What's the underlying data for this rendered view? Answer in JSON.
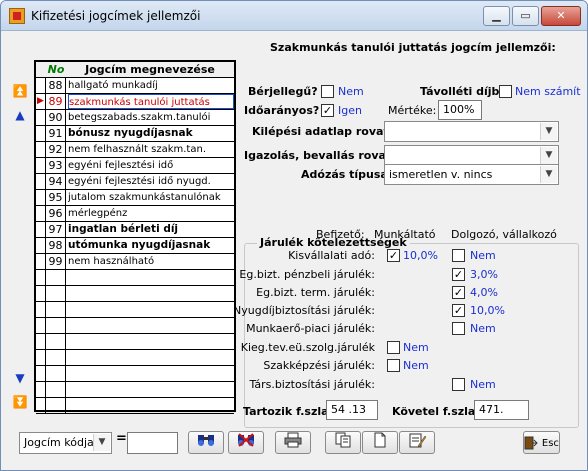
{
  "window": {
    "title": "Kifizetési jogcímek jellemzői",
    "minimize_glyph": "▁",
    "maximize_glyph": "▭",
    "close_glyph": "✕"
  },
  "nav": {
    "first_glyph": "⏫",
    "prev_glyph": "▲",
    "next_glyph": "▼",
    "last_glyph": "⏬"
  },
  "grid": {
    "col_no": "No",
    "col_name": "Jogcím megnevezése",
    "rows": [
      {
        "no": "88",
        "name": "hallgató munkadíj",
        "bold": false,
        "selected": false
      },
      {
        "no": "89",
        "name": "szakmunkás tanulói juttatás",
        "bold": false,
        "selected": true,
        "marker": "▶"
      },
      {
        "no": "90",
        "name": "betegszabads.szakm.tanulói",
        "bold": false,
        "selected": false
      },
      {
        "no": "91",
        "name": "bónusz nyugdíjasnak",
        "bold": true,
        "selected": false
      },
      {
        "no": "92",
        "name": "nem felhasznált szakm.tan.",
        "bold": false,
        "selected": false
      },
      {
        "no": "93",
        "name": "egyéni fejlesztési idő",
        "bold": false,
        "selected": false
      },
      {
        "no": "94",
        "name": "egyéni fejlesztési idő nyugd.",
        "bold": false,
        "selected": false
      },
      {
        "no": "95",
        "name": "jutalom szakmunkástanulónak",
        "bold": false,
        "selected": false
      },
      {
        "no": "96",
        "name": "mérlegpénz",
        "bold": false,
        "selected": false
      },
      {
        "no": "97",
        "name": "ingatlan bérleti díj",
        "bold": true,
        "selected": false
      },
      {
        "no": "98",
        "name": "utómunka nyugdíjasnak",
        "bold": true,
        "selected": false
      },
      {
        "no": "99",
        "name": "nem használható",
        "bold": false,
        "selected": false
      }
    ]
  },
  "detail": {
    "heading": "Szakmunkás tanulói juttatás jogcím jellemzői:",
    "berjellegu_label": "Bérjellegű? :",
    "berjellegu_value": "Nem",
    "berjellegu_checked": false,
    "tavolleti_label": "Távolléti díjba",
    "tavolleti_value": "Nem számít",
    "tavolleti_checked": false,
    "idoaranyos_label": "Időarányos? :",
    "idoaranyos_value": "Igen",
    "idoaranyos_checked": true,
    "merteke_label": "Mértéke:",
    "merteke_value": "100%",
    "kilepesi_label": "Kilépési adatlap rovata :",
    "kilepesi_value": "",
    "igazolas_label": "Igazolás, bevallás rovata :",
    "igazolas_value": "",
    "adozas_label": "Adózás típusa :",
    "adozas_value": "ismeretlen v. nincs"
  },
  "jarulek": {
    "group_title": "Járulék kötelezettségek",
    "col_befizeto": "Befizető:",
    "col_munkaltato": "Munkáltató",
    "col_dolgozo": "Dolgozó, vállalkozó",
    "rows": [
      {
        "label": "Kisvállalati adó:",
        "m_checked": true,
        "m_value": "10,0%",
        "d_checked": false,
        "d_value": "Nem"
      },
      {
        "label": "Eg.bizt. pénzbeli járulék:",
        "d_checked": true,
        "d_value": "3,0%"
      },
      {
        "label": "Eg.bizt. term. járulék:",
        "d_checked": true,
        "d_value": "4,0%"
      },
      {
        "label": "Nyugdíjbiztosítási járulék:",
        "d_checked": true,
        "d_value": "10,0%"
      },
      {
        "label": "Munkaerő-piaci járulék:",
        "d_checked": false,
        "d_value": "Nem"
      },
      {
        "label": "Kieg.tev.eü.szolg.járulék",
        "m_checked": false,
        "m_value": "Nem"
      },
      {
        "label": "Szakképzési járulék:",
        "m_checked": false,
        "m_value": "Nem"
      },
      {
        "label": "Társ.biztosítási járulék:",
        "d_checked": false,
        "d_value": "Nem"
      }
    ]
  },
  "bottom": {
    "tartozik_label": "Tartozik f.szla :",
    "tartozik_value": "54 .13",
    "kovetel_label": "Követel f.szla :",
    "kovetel_value": "471.",
    "filter_combo": "Jogcím kódja",
    "equals": "=",
    "filter_value": "",
    "exit_label": "Esc"
  },
  "colors": {
    "accent": "#1a2fd0",
    "selected_text": "#cc0000",
    "no_header": "#007a00"
  }
}
